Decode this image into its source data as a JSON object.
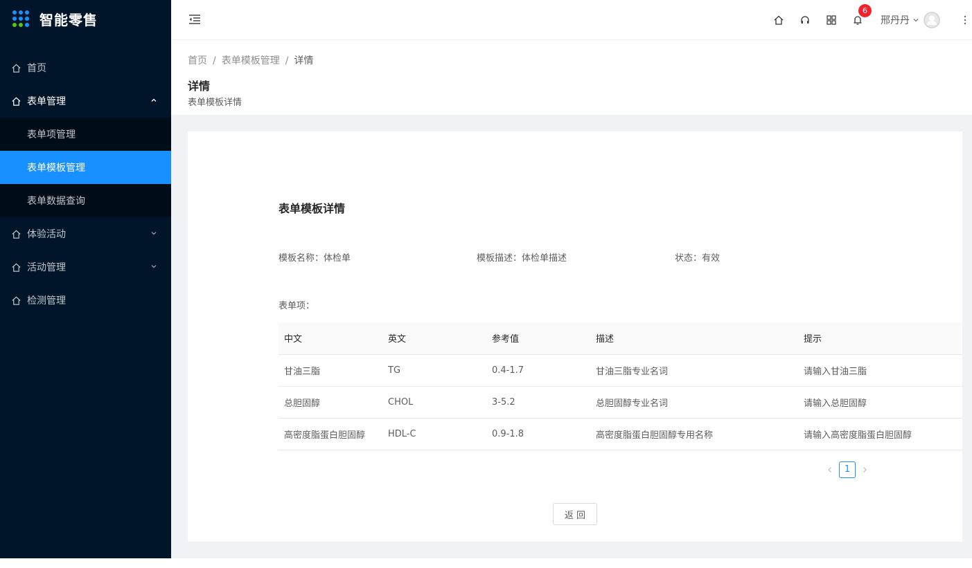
{
  "app": {
    "title": "智能零售"
  },
  "sidebar": {
    "items": [
      {
        "label": "首页"
      },
      {
        "label": "表单管理",
        "children": [
          {
            "label": "表单项管理"
          },
          {
            "label": "表单模板管理"
          },
          {
            "label": "表单数据查询"
          }
        ]
      },
      {
        "label": "体验活动"
      },
      {
        "label": "活动管理"
      },
      {
        "label": "检测管理"
      }
    ]
  },
  "header": {
    "notification_count": "6",
    "user_name": "邢丹丹"
  },
  "breadcrumb": [
    "首页",
    "/",
    "表单模板管理",
    "/",
    "详情"
  ],
  "page": {
    "title": "详情",
    "description": "表单模板详情"
  },
  "detail": {
    "title": "表单模板详情",
    "name": "模板名称：体检单",
    "desc": "模板描述：体检单描述",
    "status": "状态：有效",
    "items_label": "表单项：",
    "columns": [
      "中文",
      "英文",
      "参考值",
      "描述",
      "提示"
    ],
    "rows": [
      [
        "甘油三脂",
        "TG",
        "0.4-1.7",
        "甘油三脂专业名词",
        "请输入甘油三脂"
      ],
      [
        "总胆固醇",
        "CHOL",
        "3-5.2",
        "总胆固醇专业名词",
        "请输入总胆固醇"
      ],
      [
        "高密度脂蛋白胆固醇",
        "HDL-C",
        "0.9-1.8",
        "高密度脂蛋白胆固醇专用名称",
        "请输入高密度脂蛋白胆固醇"
      ]
    ],
    "page_current": "1",
    "back_label": "返 回"
  },
  "colors": {
    "sidebar_bg": "#001529",
    "accent": "#1890ff",
    "badge": "#f5222d"
  }
}
